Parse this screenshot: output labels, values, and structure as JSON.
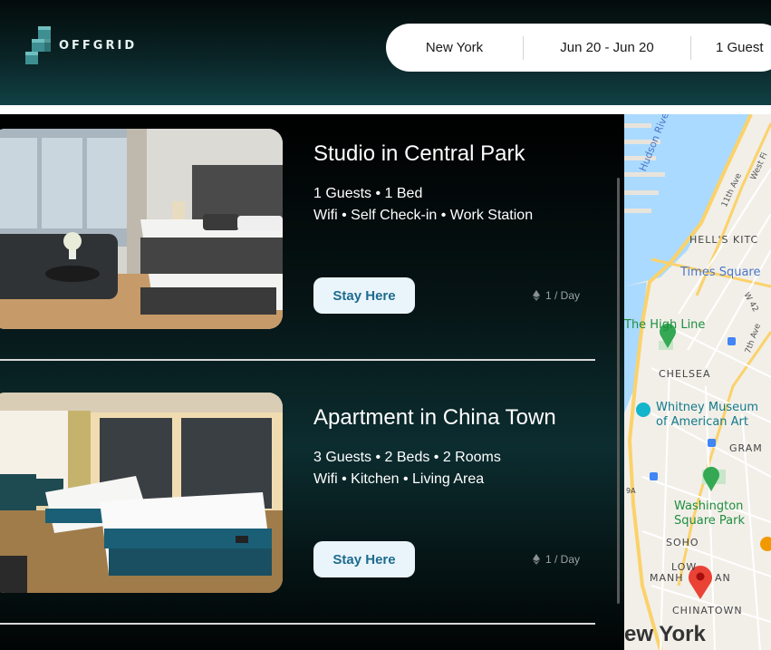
{
  "brand": {
    "name": "OFFGRID"
  },
  "search": {
    "location": "New York",
    "dates": "Jun 20 - Jun 20",
    "guests": "1 Guest"
  },
  "listings": [
    {
      "title": "Studio in Central Park",
      "specs": "1 Guests • 1 Bed",
      "amenities": "Wifi • Self Check-in • Work Station",
      "button": "Stay Here",
      "price": "1 / Day"
    },
    {
      "title": "Apartment in China Town",
      "specs": "3 Guests • 2 Beds • 2 Rooms",
      "amenities": "Wifi • Kitchen • Living Area",
      "button": "Stay Here",
      "price": "1 / Day"
    }
  ],
  "map": {
    "labels": {
      "hudson_river": "Hudson River",
      "hells_kitchen": "HELL'S KITC",
      "times_square": "Times Square",
      "high_line": "The High Line",
      "chelsea": "CHELSEA",
      "whitney_1": "Whitney Museum",
      "whitney_2": "of American Art",
      "gramercy": "GRAM",
      "washington_1": "Washington",
      "washington_2": "Square Park",
      "soho": "SOHO",
      "lower_manhattan_1": "LOW",
      "lower_manhattan_2": "MANH",
      "lower_manhattan_3": "AN",
      "chinatown": "CHINATOWN",
      "new_york": "ew York",
      "ave_11": "11th Ave",
      "ave_7": "7th Ave",
      "west_st": "West Fi",
      "w42": "W 42",
      "route_9a": "9A"
    }
  },
  "colors": {
    "accent": "#1e6b8e",
    "button_bg": "#eaf5fb",
    "header_teal": "#114145",
    "map_water": "#aadaff",
    "map_pin": "#ea4335",
    "park_green": "#34a853"
  }
}
